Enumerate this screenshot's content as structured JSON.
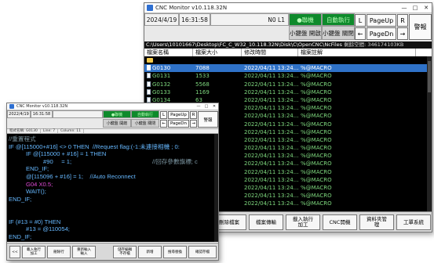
{
  "back_window": {
    "title": "CNC Monitor v10.118.32N",
    "window_controls": [
      "—",
      "□",
      "✕"
    ],
    "date": "2024/4/19",
    "time": "16:31:58",
    "machine": "N0 L1",
    "status_online": "●聯機",
    "status_auto": "自動執行",
    "mode_left": "小鍵盤 開啟",
    "mode_right": "小鍵盤 關閉",
    "keys": {
      "l": "L",
      "l_arrow": "←",
      "page_up": "PageUp",
      "page_dn": "PageDn",
      "r": "R",
      "r_arrow": "→",
      "alarm": "警報"
    },
    "path": "C:\\Users\\10101667\\Desktop\\FC_C_W32_10.118.32N\\Disk\\C\\OpenCNC\\NcFiles",
    "used_space": "剩餘空間: 346174103KB",
    "columns": [
      "檔案名稱",
      "檔案大小",
      "修改時間",
      "檔案註解"
    ],
    "files": [
      {
        "name": "",
        "size": "",
        "time": "",
        "note": "",
        "folder": true
      },
      {
        "name": "G0130",
        "size": "7088",
        "time": "2022/04/11 13:24...",
        "note": "%@MACRO",
        "selected": true
      },
      {
        "name": "G0131",
        "size": "1533",
        "time": "2022/04/11 13:24...",
        "note": "%@MACRO"
      },
      {
        "name": "G0132",
        "size": "5568",
        "time": "2022/04/11 13:24...",
        "note": "%@MACRO"
      },
      {
        "name": "G0133",
        "size": "1169",
        "time": "2022/04/11 13:24...",
        "note": "%@MACRO"
      },
      {
        "name": "G0134",
        "size": "63",
        "time": "2022/04/11 13:24...",
        "note": "%@MACRO"
      },
      {
        "name": "",
        "size": "",
        "time": "2022/04/11 13:24...",
        "note": "%@MACRO"
      },
      {
        "name": "",
        "size": "",
        "time": "2022/04/11 13:24...",
        "note": "%@MACRO"
      },
      {
        "name": "",
        "size": "",
        "time": "2022/04/11 13:24...",
        "note": "%@MACRO"
      },
      {
        "name": "",
        "size": "",
        "time": "2022/04/11 13:24...",
        "note": "%@MACRO"
      },
      {
        "name": "",
        "size": "",
        "time": "2022/04/11 13:24...",
        "note": "%@MACRO"
      },
      {
        "name": "",
        "size": "",
        "time": "2022/04/11 13:24...",
        "note": "%@MACRO"
      },
      {
        "name": "",
        "size": "",
        "time": "2022/04/11 13:24...",
        "note": "%@MACRO"
      },
      {
        "name": "",
        "size": "",
        "time": "2022/04/11 13:24...",
        "note": "%@MACRO"
      },
      {
        "name": "",
        "size": "",
        "time": "2022/04/11 13:24...",
        "note": "%@MACRO"
      },
      {
        "name": "",
        "size": "",
        "time": "2022/04/11 13:24...",
        "note": "%@MACRO"
      },
      {
        "name": "",
        "size": "",
        "time": "2022/04/11 13:24...",
        "note": "%@MACRO"
      },
      {
        "name": "",
        "size": "",
        "time": "2022/04/11 13:24...",
        "note": "%@MACRO"
      },
      {
        "name": "",
        "size": "",
        "time": "2022/04/11 13:24...",
        "note": "%@MACRO"
      }
    ],
    "bottom_buttons": [
      "刪除檔案",
      "檔案傳輸",
      "載入執行\n加工",
      "CNC開機",
      "資料夾管\n理",
      "工單系統"
    ]
  },
  "front_window": {
    "title": "CNC Monitor v10.118.32N",
    "window_controls": [
      "—",
      "□",
      "✕"
    ],
    "date": "2022/4/19",
    "time": "16:31:58",
    "status_online": "●聯機",
    "status_auto": "自動執行",
    "mode_left": "小鍵盤 開啟",
    "mode_right": "小鍵盤 關閉",
    "keys": {
      "l": "L",
      "l_arrow": "←",
      "page_up": "PageUp",
      "page_dn": "PageDn",
      "r": "R",
      "r_arrow": "→",
      "alarm": "警報"
    },
    "status": [
      "程式名稱: G0130",
      "Line: 7",
      "Column: 11"
    ],
    "code": [
      {
        "text": "//重置程式",
        "cls": "cmt",
        "indent": 0
      },
      {
        "text": "IF @[115000+#16] <> 0 THEN  //Request flag:(-1:未連接相機 ; 0:",
        "cls": "",
        "indent": 0
      },
      {
        "text": "IF @[115000 + #16] = 1 THEN",
        "cls": "",
        "indent": 1
      },
      {
        "text": "#90     = 1;",
        "cls": "",
        "indent": 2
      },
      {
        "text": "//回存參數旗標; c",
        "cls": "cmt",
        "indent": 5
      },
      {
        "text": "END_IF;",
        "cls": "",
        "indent": 1
      },
      {
        "text": "@[115096 + #16] = 1;    //Auto Reconnect",
        "cls": "",
        "indent": 1
      },
      {
        "text": "G04 X0.5;",
        "cls": "mag",
        "indent": 1
      },
      {
        "text": "WAIT();",
        "cls": "",
        "indent": 1
      },
      {
        "text": "END_IF;",
        "cls": "",
        "indent": 0
      },
      {
        "text": "",
        "cls": "",
        "indent": 0
      },
      {
        "text": "",
        "cls": "",
        "indent": 0
      },
      {
        "text": "IF (#13 = #0) THEN",
        "cls": "",
        "indent": 0
      },
      {
        "text": "#13 = @110054;",
        "cls": "",
        "indent": 1
      },
      {
        "text": "END_IF;",
        "cls": "",
        "indent": 0
      }
    ],
    "bottom_buttons": [
      "<<",
      "載入執行\n加工",
      "刪除行",
      "重新輸入\n輸入",
      "儲存編輯\n不存檔",
      "新增",
      "搜尋替換",
      "確認存檔"
    ]
  }
}
